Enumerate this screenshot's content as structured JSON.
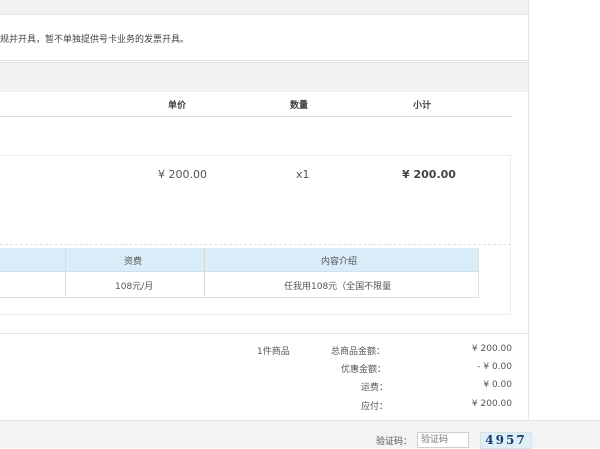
{
  "notice_text": "规并开具，暂不单独提供号卡业务的发票开具。",
  "table_headers": {
    "price": "单价",
    "quantity": "数量",
    "subtotal": "小计"
  },
  "item": {
    "price": "¥ 200.00",
    "quantity": "x1",
    "subtotal": "¥ 200.00"
  },
  "package_table": {
    "headers": [
      "资费",
      "内容介绍"
    ],
    "row": [
      "108元/月",
      "任我用108元（全国不限量"
    ]
  },
  "summary": {
    "item_count": "1件商品",
    "total_label": "总商品金额：",
    "total_value": "¥ 200.00",
    "discount_label": "优惠金额：",
    "discount_value": "- ¥ 0.00",
    "shipping_label": "运费：",
    "shipping_value": "¥ 0.00",
    "payable_label": "应付：",
    "payable_value": "¥ 200.00"
  },
  "captcha": {
    "label": "验证码：",
    "placeholder": "验证码",
    "image_text": "4957"
  },
  "colors": {
    "header_blue": "#d9ecf8",
    "panel_gray": "#f2f2f2"
  }
}
